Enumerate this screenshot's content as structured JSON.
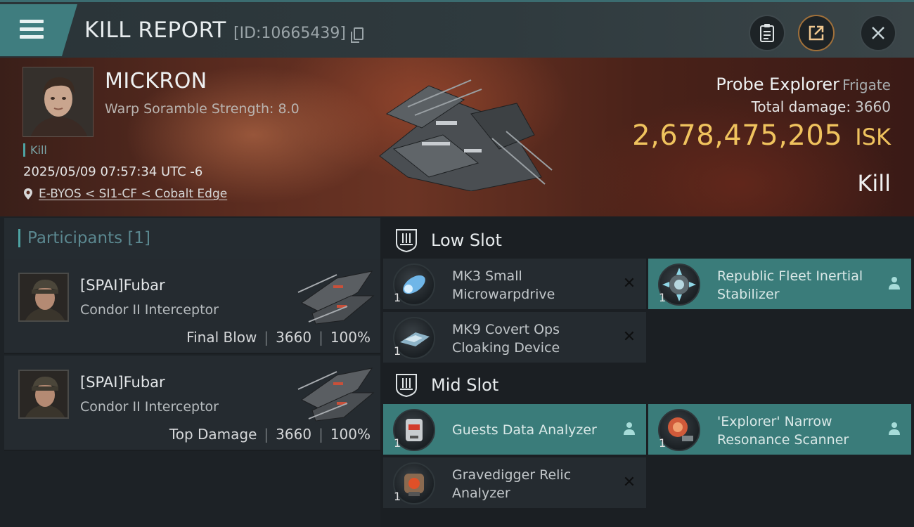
{
  "header": {
    "title": "KILL REPORT",
    "report_id": "[ID:10665439]",
    "icons": [
      "menu-icon",
      "copy-icon",
      "clipboard-icon",
      "share-icon",
      "close-icon"
    ]
  },
  "victim": {
    "name": "MICKRON",
    "warp_scramble": "Warp Soramble Strength: 8.0",
    "tag": "Kill",
    "timestamp": "2025/05/09 07:57:34 UTC -6",
    "location": "E-BYOS < SI1-CF < Cobalt Edge",
    "ship_name": "Probe Explorer",
    "ship_class": "Frigate",
    "total_damage_label": "Total damage:",
    "total_damage_value": "3660",
    "isk_value": "2,678,475,205",
    "isk_unit": "ISK",
    "result": "Kill"
  },
  "participants": {
    "label": "Participants [1]",
    "rows": [
      {
        "name": "[SPAI]Fubar",
        "ship": "Condor II Interceptor",
        "role": "Final Blow",
        "damage": "3660",
        "percent": "100%"
      },
      {
        "name": "[SPAI]Fubar",
        "ship": "Condor II Interceptor",
        "role": "Top Damage",
        "damage": "3660",
        "percent": "100%"
      }
    ]
  },
  "fittings": {
    "low_slot": {
      "title": "Low Slot",
      "modules": [
        {
          "name": "MK3 Small Microwarpdrive",
          "qty": "1",
          "status": "destroyed",
          "status_icon": "close-icon"
        },
        {
          "name": "Republic Fleet Inertial Stabilizer",
          "qty": "1",
          "status": "dropped",
          "status_icon": "person-icon"
        },
        {
          "name": "MK9 Covert Ops Cloaking Device",
          "qty": "1",
          "status": "destroyed",
          "status_icon": "close-icon"
        }
      ]
    },
    "mid_slot": {
      "title": "Mid Slot",
      "modules": [
        {
          "name": "Guests Data Analyzer",
          "qty": "1",
          "status": "dropped",
          "status_icon": "person-icon"
        },
        {
          "name": "'Explorer' Narrow Resonance Scanner",
          "qty": "1",
          "status": "dropped",
          "status_icon": "person-icon"
        },
        {
          "name": "Gravedigger Relic Analyzer",
          "qty": "1",
          "status": "destroyed",
          "status_icon": "close-icon"
        }
      ]
    }
  },
  "colors": {
    "accent_teal": "#3f7d7f",
    "isk_gold": "#f0c35e",
    "highlight_row": "#3a7c7a"
  }
}
